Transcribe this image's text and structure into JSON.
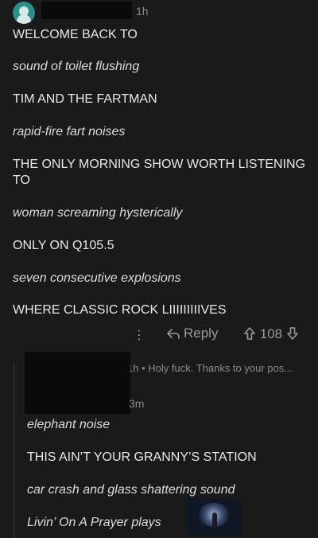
{
  "post": {
    "timestamp": "1h",
    "lines": [
      "WELCOME BACK TO",
      "sound of toilet flushing",
      "TIM AND THE FARTMAN",
      "rapid-fire fart noises",
      "THE ONLY MORNING SHOW WORTH LISTENING TO",
      "woman screaming hysterically",
      "ONLY ON Q105.5",
      "seven consecutive explosions",
      "WHERE CLASSIC ROCK LIIIIIIIIIVES"
    ],
    "actions": {
      "more": "⋮",
      "reply_label": "Reply",
      "score": "108"
    }
  },
  "reply": {
    "meta": "1h • Holy fuck. Thanks to your pos...",
    "timestamp": "3m",
    "lines": [
      "elephant noise",
      "THIS AIN’T YOUR GRANNY’S STATION",
      "car crash and glass shattering sound",
      "Livin’ On A Prayer plays"
    ]
  },
  "icons": {
    "avatar": "avatar-icon",
    "reply": "reply-arrow-icon",
    "upvote": "upvote-arrow-icon",
    "downvote": "downvote-arrow-icon"
  }
}
